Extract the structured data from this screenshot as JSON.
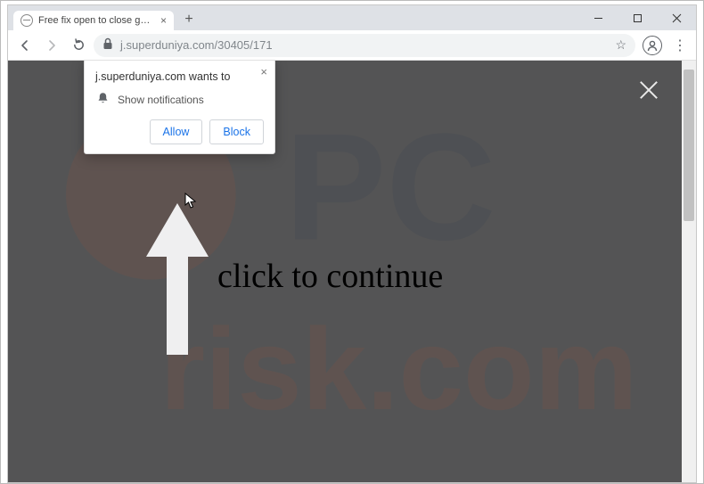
{
  "window": {
    "tab_title": "Free fix open to close game"
  },
  "addressbar": {
    "host": "j.superduniya.com",
    "path": "/30405/171"
  },
  "permission": {
    "title_prefix": "j.superduniya.com",
    "title_suffix": " wants to",
    "option": "Show notifications",
    "allow": "Allow",
    "block": "Block"
  },
  "page": {
    "cta": "click to continue"
  },
  "watermark": {
    "line1": "PC",
    "line2": "risk.com"
  }
}
